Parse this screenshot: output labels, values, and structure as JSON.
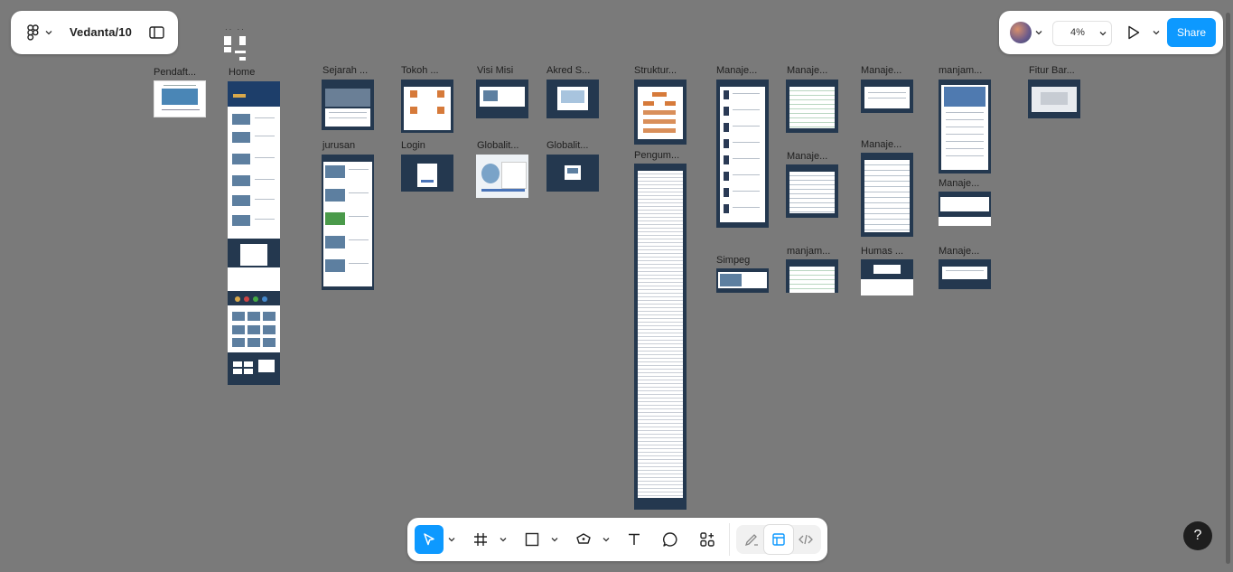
{
  "header": {
    "file_name": "Vedanta/10",
    "zoom": "4%",
    "share_label": "Share"
  },
  "canvas": {
    "frames": [
      {
        "label": "Pendaft..."
      },
      {
        "label": "Home"
      },
      {
        "label": "Sejarah ..."
      },
      {
        "label": "jurusan"
      },
      {
        "label": "Tokoh ..."
      },
      {
        "label": "Login"
      },
      {
        "label": "Visi Misi"
      },
      {
        "label": "Globalit..."
      },
      {
        "label": "Akred S..."
      },
      {
        "label": "Globalit..."
      },
      {
        "label": "Struktur..."
      },
      {
        "label": "Pengum..."
      },
      {
        "label": "Manaje..."
      },
      {
        "label": "Simpeg"
      },
      {
        "label": "Manaje..."
      },
      {
        "label": "Manaje..."
      },
      {
        "label": "manjam..."
      },
      {
        "label": "Manaje..."
      },
      {
        "label": "Manaje..."
      },
      {
        "label": "Humas ..."
      },
      {
        "label": "manjam..."
      },
      {
        "label": "Manaje..."
      },
      {
        "label": "Manaje..."
      },
      {
        "label": "Fitur Bar..."
      }
    ]
  },
  "toolbar": {
    "tools": [
      "move-tool",
      "frame-tool",
      "shape-tool",
      "pen-tool",
      "text-tool",
      "comment-tool",
      "actions-tool"
    ],
    "modes": [
      "draw-mode",
      "design-mode",
      "dev-mode"
    ]
  },
  "help_label": "?",
  "colors": {
    "canvas_bg": "#7a7a7a",
    "accent": "#0d99ff",
    "frame_dark": "#24384f"
  }
}
